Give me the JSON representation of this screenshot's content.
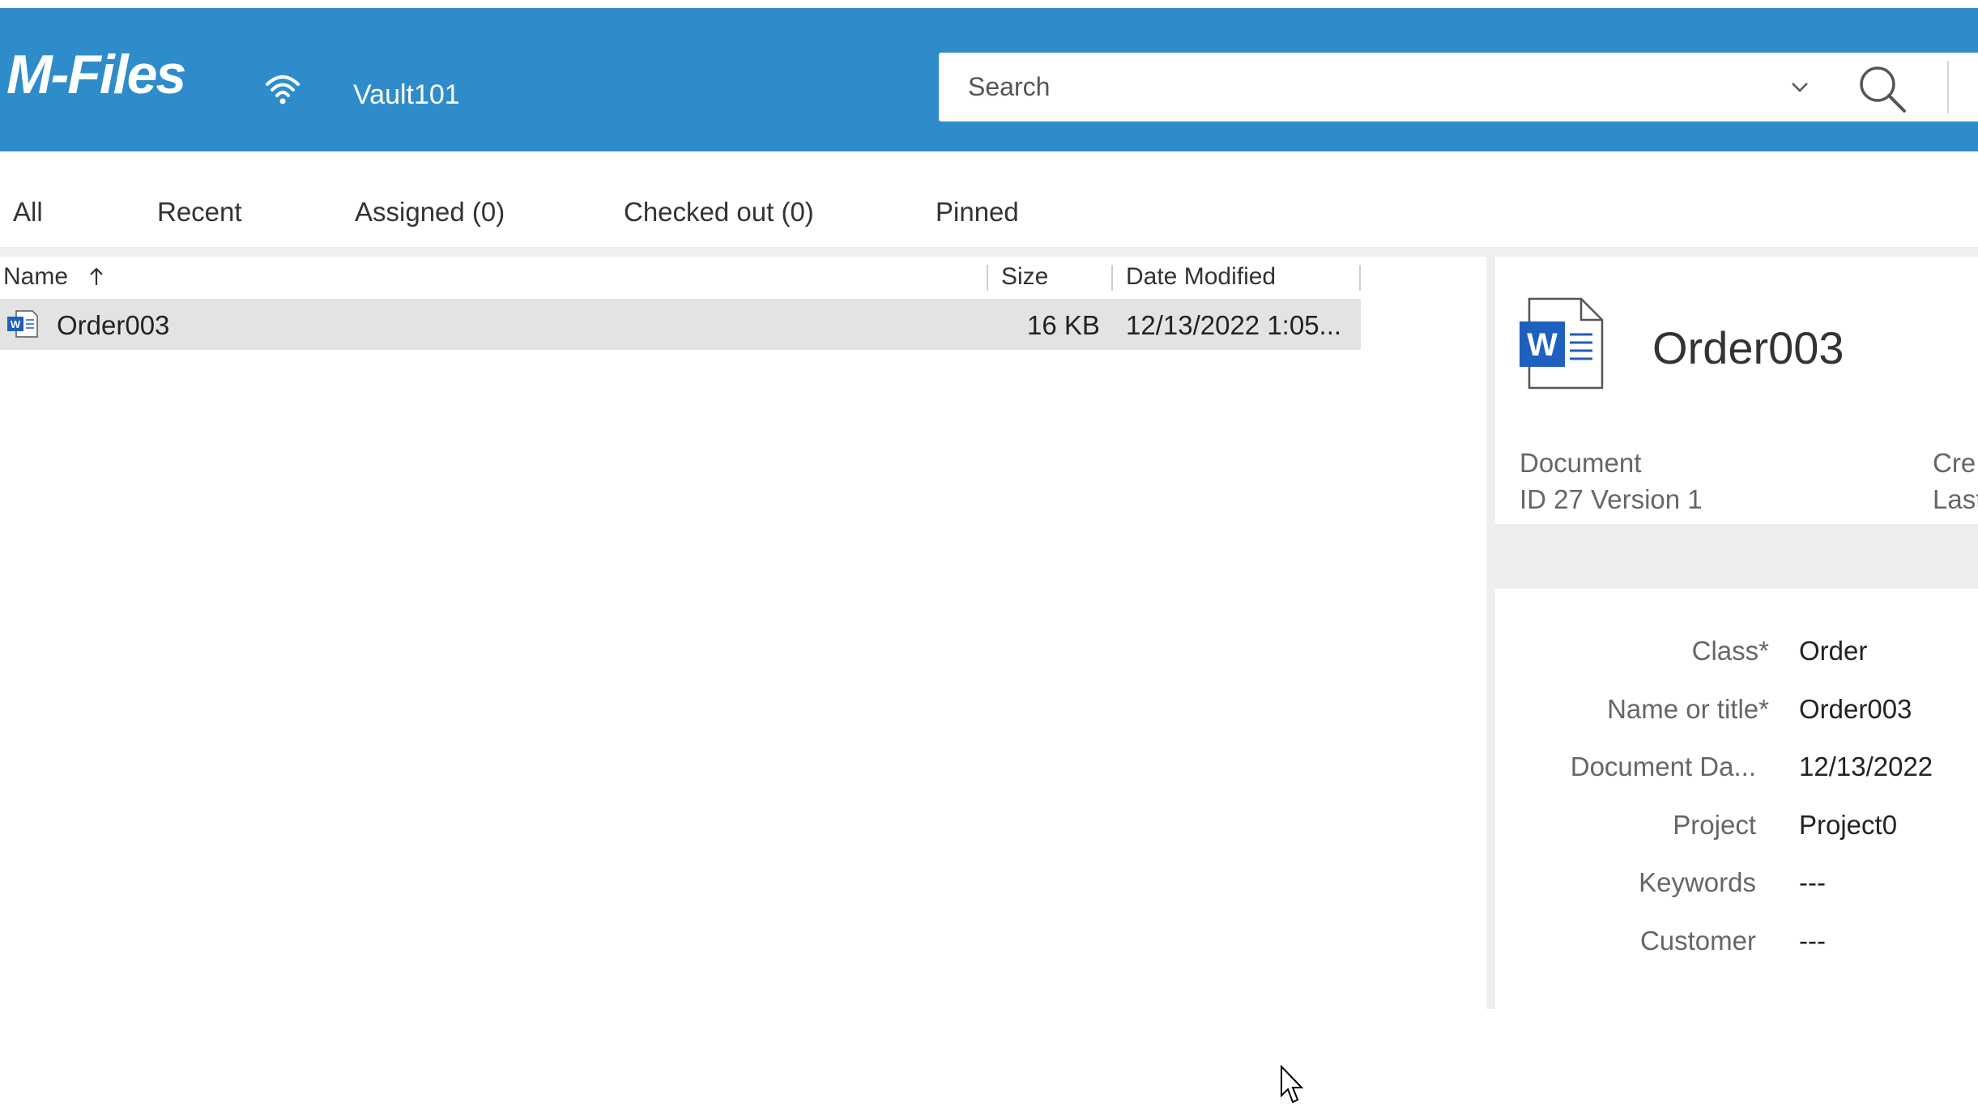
{
  "app": {
    "logo_text": "M-Files",
    "vault_name": "Vault101",
    "connection_icon": "wifi-icon",
    "accent_color": "#2f8ccb"
  },
  "search": {
    "placeholder": "Search",
    "dropdown_icon": "chevron-down-icon",
    "search_icon": "magnifier-icon"
  },
  "tabs": [
    {
      "label": "All"
    },
    {
      "label": "Recent"
    },
    {
      "label": "Assigned (0)"
    },
    {
      "label": "Checked out (0)"
    },
    {
      "label": "Pinned"
    }
  ],
  "list": {
    "columns": {
      "name": "Name",
      "name_sort_icon": "arrow-up-icon",
      "size": "Size",
      "date_modified": "Date Modified"
    },
    "rows": [
      {
        "icon": "word-document-icon",
        "name": "Order003",
        "size": "16 KB",
        "date_modified": "12/13/2022 1:05..."
      }
    ]
  },
  "details": {
    "title": "Order003",
    "icon": "word-document-icon",
    "object_type": "Document",
    "id_version": "ID 27  Version 1",
    "created_label_truncated": "Cre",
    "last_label_truncated": "Last",
    "properties": [
      {
        "label": "Class",
        "required": true,
        "value": "Order"
      },
      {
        "label": "Name or title",
        "required": true,
        "value": "Order003"
      },
      {
        "label": "Document Da...",
        "required": false,
        "value": "12/13/2022"
      },
      {
        "label": "Project",
        "required": false,
        "value": "Project0"
      },
      {
        "label": "Keywords",
        "required": false,
        "value": "---"
      },
      {
        "label": "Customer",
        "required": false,
        "value": "---"
      }
    ]
  }
}
